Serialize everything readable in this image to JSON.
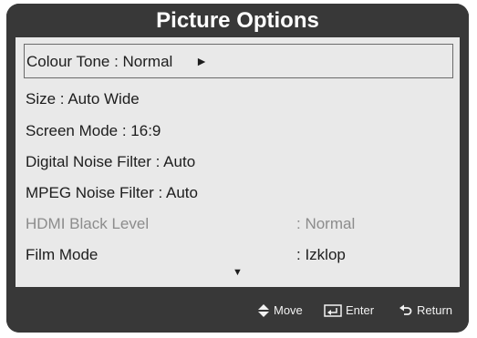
{
  "title": "Picture Options",
  "menu": [
    {
      "label": "Colour Tone",
      "sep": " : ",
      "value": "Normal"
    },
    {
      "label": "Size",
      "sep": " : ",
      "value": "Auto Wide"
    },
    {
      "label": "Screen Mode",
      "sep": " : ",
      "value": "16:9"
    },
    {
      "label": "Digital Noise Filter",
      "sep": " : ",
      "value": "Auto"
    },
    {
      "label": "MPEG Noise Filter",
      "sep": " : ",
      "value": "Auto"
    },
    {
      "label": "HDMI Black Level",
      "sep": ": ",
      "value": "Normal"
    },
    {
      "label": "Film Mode",
      "sep": ": ",
      "value": "Izklop"
    }
  ],
  "selected_arrow": "►",
  "more_indicator": "▼",
  "footer": {
    "move": "Move",
    "enter": "Enter",
    "return": "Return"
  },
  "colors": {
    "frame": "#383838",
    "panel": "#e9e9e9",
    "disabled_text": "#8c8c8c"
  }
}
